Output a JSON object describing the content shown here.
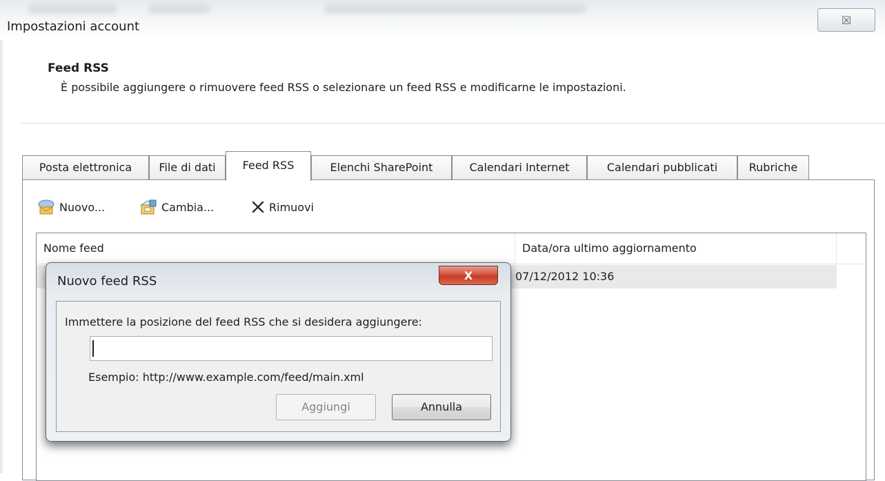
{
  "window": {
    "title": "Impostazioni account",
    "close_glyph": "☒"
  },
  "header": {
    "title": "Feed RSS",
    "description": "È possibile aggiungere o rimuovere feed RSS o selezionare un feed RSS e modificarne le impostazioni."
  },
  "tabs": [
    {
      "label": "Posta elettronica",
      "active": false
    },
    {
      "label": "File di dati",
      "active": false
    },
    {
      "label": "Feed RSS",
      "active": true
    },
    {
      "label": "Elenchi SharePoint",
      "active": false
    },
    {
      "label": "Calendari Internet",
      "active": false
    },
    {
      "label": "Calendari pubblicati",
      "active": false
    },
    {
      "label": "Rubriche",
      "active": false
    }
  ],
  "toolbar": {
    "new_label": "Nuovo...",
    "new_icon": "new-feed-icon",
    "change_label": "Cambia...",
    "change_icon": "change-feed-icon",
    "remove_label": "Rimuovi",
    "remove_icon": "remove-x-icon"
  },
  "feed_list": {
    "columns": [
      "Nome feed",
      "Data/ora ultimo aggiornamento"
    ],
    "rows": [
      {
        "name": "",
        "updated": "07/12/2012 10:36"
      }
    ]
  },
  "dialog": {
    "title": "Nuovo feed RSS",
    "close_glyph": "X",
    "prompt": "Immettere la posizione del feed RSS che si desidera aggiungere:",
    "url_value": "",
    "example": "Esempio: http://www.example.com/feed/main.xml",
    "add_label": "Aggiungi",
    "add_enabled": false,
    "cancel_label": "Annulla"
  },
  "colors": {
    "close_button_red": "#c63b25",
    "tab_border": "#898c95",
    "row_highlight": "#e9e9e9"
  }
}
